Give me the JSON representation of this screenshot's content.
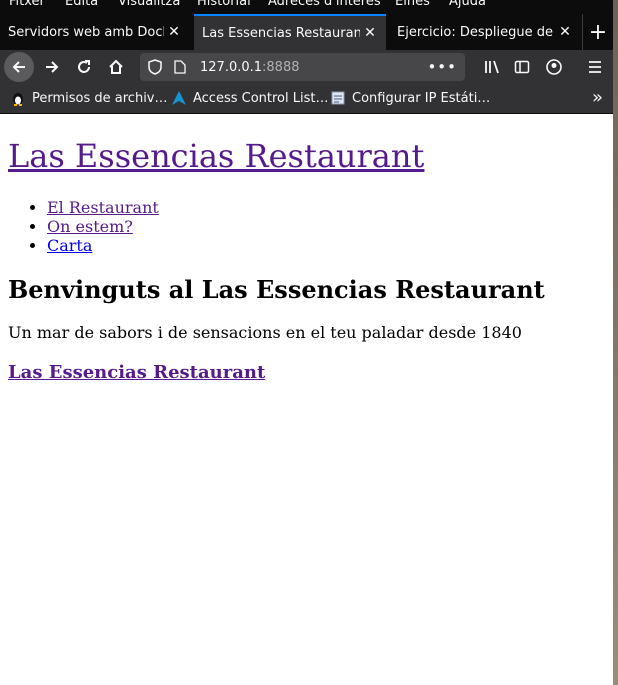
{
  "browser": {
    "menu": [
      "Fitxer",
      "Edita",
      "Visualitza",
      "Historial",
      "Adreces d'interès",
      "Eines",
      "Ajuda"
    ],
    "tabs": [
      {
        "label": "Servidors web amb Docke",
        "active": false
      },
      {
        "label": "Las Essencias Restaurant",
        "active": true
      },
      {
        "label": "Ejercicio: Despliegue de p",
        "active": false
      }
    ],
    "new_tab": "+",
    "url": {
      "host": "127.0.0.1",
      "port": ":8888"
    },
    "bookmarks": [
      {
        "label": "Permisos de archiv…",
        "icon": "linux-penguin-icon"
      },
      {
        "label": "Access Control List…",
        "icon": "arch-linux-icon"
      },
      {
        "label": "Configurar IP Estáti…",
        "icon": "document-icon"
      }
    ],
    "more_bookmarks": "»"
  },
  "page": {
    "site_title": "Las Essencias Restaurant",
    "nav": [
      {
        "label": "El Restaurant",
        "visited": true
      },
      {
        "label": "On estem?",
        "visited": true
      },
      {
        "label": "Carta",
        "visited": false
      }
    ],
    "heading": "Benvinguts al Las Essencias Restaurant",
    "tagline": "Un mar de sabors i de sensacions en el teu paladar desde 1840",
    "footer_link": "Las Essencias Restaurant"
  },
  "colors": {
    "accent": "#0a84ff",
    "visited_link": "#551a8b",
    "link": "#0000ee",
    "chrome_dark": "#0c0c0d",
    "toolbar": "#323234"
  }
}
